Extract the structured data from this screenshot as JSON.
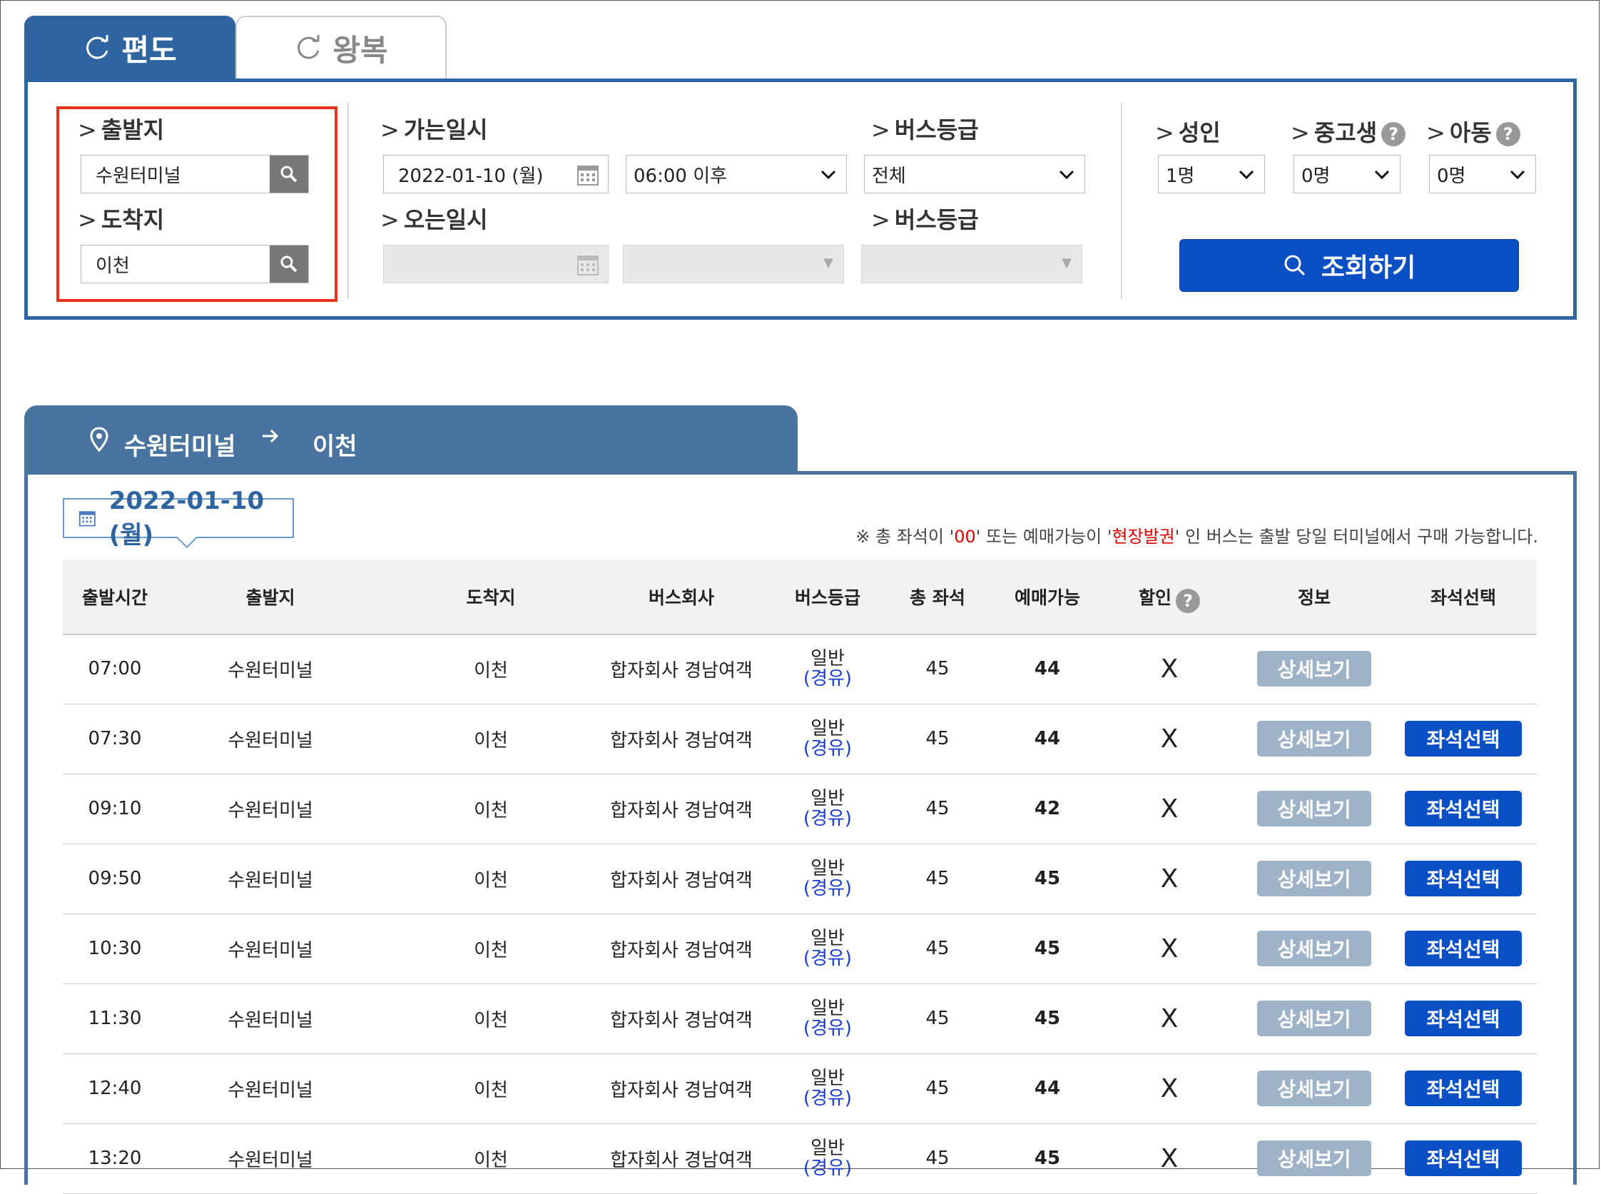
{
  "tabs": {
    "oneway": "편도",
    "roundtrip": "왕복"
  },
  "search": {
    "departure_label": "출발지",
    "departure_value": "수원터미널",
    "arrival_label": "도착지",
    "arrival_value": "이천",
    "go_date_label": "가는일시",
    "go_date_value": "2022-01-10 (월)",
    "go_time_value": "06:00 이후",
    "bus_grade_label": "버스등급",
    "bus_grade_value": "전체",
    "return_date_label": "오는일시",
    "return_bus_grade_label": "버스등급",
    "adult_label": "성인",
    "adult_value": "1명",
    "student_label": "중고생",
    "student_value": "0명",
    "child_label": "아동",
    "child_value": "0명",
    "search_button": "조회하기"
  },
  "route": {
    "from": "수원터미널",
    "to": "이천"
  },
  "date_badge": "2022-01-10 (월)",
  "notice": {
    "part1": "※ 총 좌석이 '",
    "red1": "00",
    "part2": "' 또는 예매가능이 '",
    "red2": "현장발권",
    "part3": "' 인 버스는 출발 당일 터미널에서 구매 가능합니다."
  },
  "table": {
    "headers": {
      "time": "출발시간",
      "from": "출발지",
      "to": "도착지",
      "company": "버스회사",
      "grade": "버스등급",
      "total": "총 좌석",
      "available": "예매가능",
      "discount": "할인",
      "info": "정보",
      "seat": "좌석선택"
    },
    "detail_label": "상세보기",
    "seat_label": "좌석선택",
    "rows": [
      {
        "time": "07:00",
        "from": "수원터미널",
        "to": "이천",
        "company": "합자회사 경남여객",
        "grade": "일반",
        "via": "(경유)",
        "total": "45",
        "available": "44",
        "discount": "X"
      },
      {
        "time": "07:30",
        "from": "수원터미널",
        "to": "이천",
        "company": "합자회사 경남여객",
        "grade": "일반",
        "via": "(경유)",
        "total": "45",
        "available": "44",
        "discount": "X"
      },
      {
        "time": "09:10",
        "from": "수원터미널",
        "to": "이천",
        "company": "합자회사 경남여객",
        "grade": "일반",
        "via": "(경유)",
        "total": "45",
        "available": "42",
        "discount": "X"
      },
      {
        "time": "09:50",
        "from": "수원터미널",
        "to": "이천",
        "company": "합자회사 경남여객",
        "grade": "일반",
        "via": "(경유)",
        "total": "45",
        "available": "45",
        "discount": "X"
      },
      {
        "time": "10:30",
        "from": "수원터미널",
        "to": "이천",
        "company": "합자회사 경남여객",
        "grade": "일반",
        "via": "(경유)",
        "total": "45",
        "available": "45",
        "discount": "X"
      },
      {
        "time": "11:30",
        "from": "수원터미널",
        "to": "이천",
        "company": "합자회사 경남여객",
        "grade": "일반",
        "via": "(경유)",
        "total": "45",
        "available": "45",
        "discount": "X"
      },
      {
        "time": "12:40",
        "from": "수원터미널",
        "to": "이천",
        "company": "합자회사 경남여객",
        "grade": "일반",
        "via": "(경유)",
        "total": "45",
        "available": "44",
        "discount": "X"
      },
      {
        "time": "13:20",
        "from": "수원터미널",
        "to": "이천",
        "company": "합자회사 경남여객",
        "grade": "일반",
        "via": "(경유)",
        "total": "45",
        "available": "45",
        "discount": "X"
      }
    ]
  }
}
